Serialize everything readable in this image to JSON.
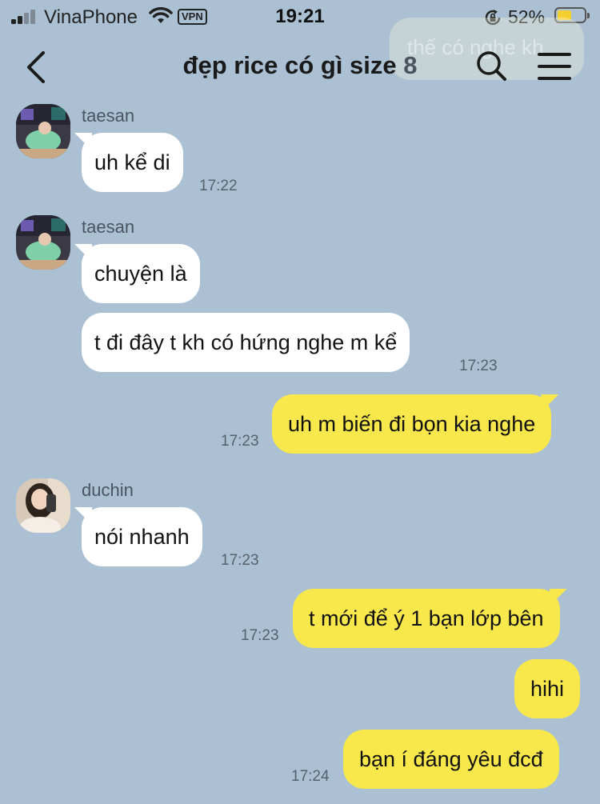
{
  "status_bar": {
    "carrier": "VinaPhone",
    "vpn": "VPN",
    "time": "19:21",
    "battery_percent": "52%",
    "battery_level": 0.52,
    "icons": [
      "signal-icon",
      "wifi-icon",
      "orientation-lock-icon",
      "battery-icon"
    ]
  },
  "ghost_message": "thế có nghe kh",
  "header": {
    "title": "đẹp rice có gì size",
    "member_count": "8",
    "icons": [
      "back-icon",
      "search-icon",
      "menu-icon"
    ]
  },
  "messages": {
    "m1": {
      "sender": "taesan",
      "text": "uh kể di",
      "time": "17:22"
    },
    "m2": {
      "sender": "taesan",
      "text": "chuyện là"
    },
    "m3": {
      "text": "t đi đây t kh có hứng nghe m kể",
      "time": "17:23"
    },
    "m4": {
      "text": "uh m biến đi bọn kia nghe",
      "time": "17:23"
    },
    "m5": {
      "sender": "duchin",
      "text": "nói nhanh",
      "time": "17:23"
    },
    "m6": {
      "text": "t mới để ý 1 bạn lớp bên",
      "time": "17:23"
    },
    "m7": {
      "text": "hihi"
    },
    "m8": {
      "text": "bạn í đáng yêu đcđ",
      "time": "17:24"
    }
  },
  "colors": {
    "background": "#abc0d3",
    "outgoing_bubble": "#f8e84b",
    "incoming_bubble": "#ffffff"
  }
}
